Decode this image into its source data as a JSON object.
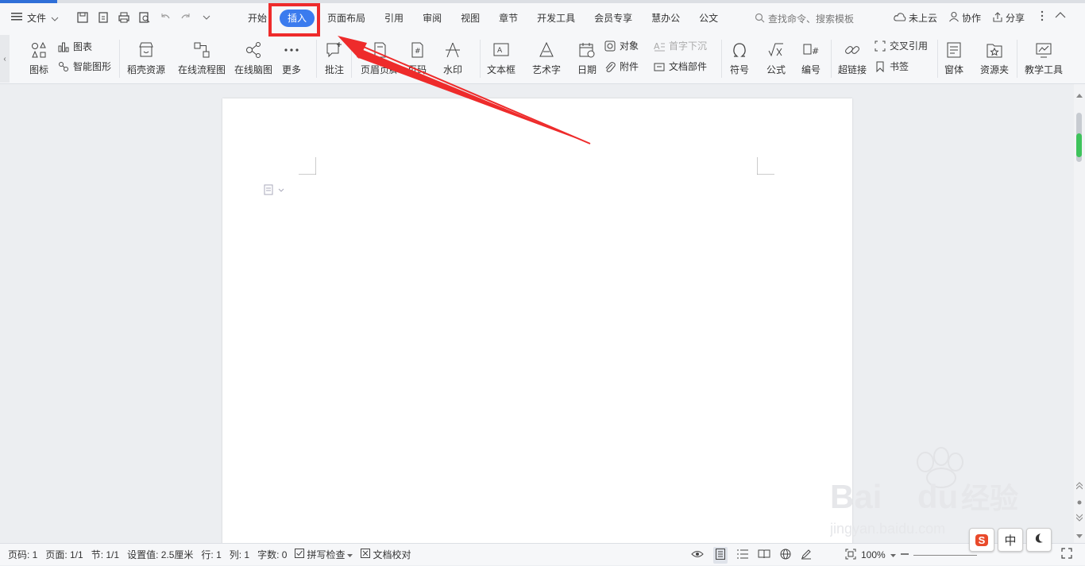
{
  "file_menu": {
    "label": "文件"
  },
  "tabs": [
    {
      "label": "开始"
    },
    {
      "label": "插入"
    },
    {
      "label": "页面布局"
    },
    {
      "label": "引用"
    },
    {
      "label": "审阅"
    },
    {
      "label": "视图"
    },
    {
      "label": "章节"
    },
    {
      "label": "开发工具"
    },
    {
      "label": "会员专享"
    },
    {
      "label": "慧办公"
    },
    {
      "label": "公文"
    }
  ],
  "search": {
    "placeholder": "查找命令、搜索模板"
  },
  "right_actions": {
    "cloud": "未上云",
    "collab": "协作",
    "share": "分享"
  },
  "ribbon": {
    "icon": "图标",
    "chart": "图表",
    "smart": "智能图形",
    "daoke": "稻壳资源",
    "flow": "在线流程图",
    "mind": "在线脑图",
    "more": "更多",
    "comment": "批注",
    "header_footer": "页眉页脚",
    "page_num": "页码",
    "watermark": "水印",
    "textbox": "文本框",
    "wordart": "艺术字",
    "date": "日期",
    "object": "对象",
    "attach": "附件",
    "dropcap": "首字下沉",
    "docpart": "文档部件",
    "symbol": "符号",
    "formula": "公式",
    "number": "编号",
    "hyperlink": "超链接",
    "crossref": "交叉引用",
    "bookmark": "书签",
    "window": "窗体",
    "resource": "资源夹",
    "teach": "教学工具"
  },
  "status": {
    "page_code": "页码: 1",
    "pages": "页面: 1/1",
    "section": "节: 1/1",
    "setting": "设置值: 2.5厘米",
    "row": "行: 1",
    "col": "列: 1",
    "words": "字数: 0",
    "spell": "拼写检查",
    "proof": "文档校对",
    "zoom": "100%"
  },
  "ime": {
    "sogou": "S",
    "lang": "中"
  },
  "watermark_text": {
    "brand": "Bai du 经验",
    "url": "jingyan.baidu.com"
  },
  "colors": {
    "accent": "#3b7bee",
    "highlight": "#ee2b2b"
  }
}
